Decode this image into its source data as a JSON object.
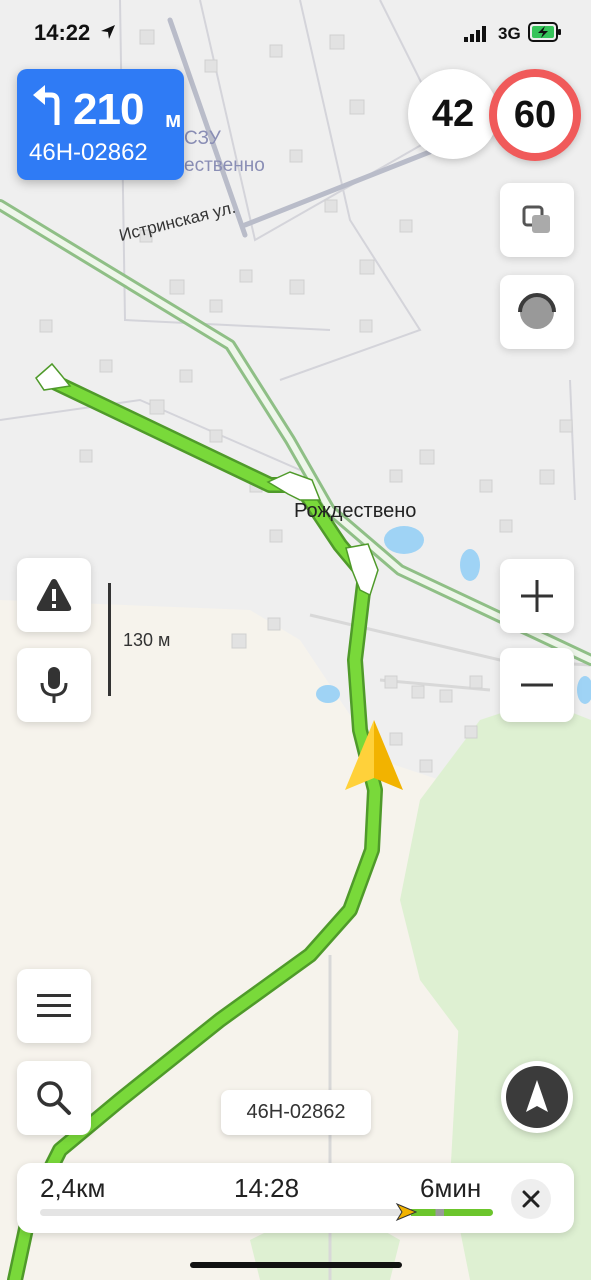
{
  "status_bar": {
    "time": "14:22",
    "network": "3G"
  },
  "maneuver": {
    "distance": "210",
    "unit": "м",
    "road": "46Н-02862",
    "turn": "left"
  },
  "speed": {
    "current": "42",
    "limit": "60"
  },
  "map": {
    "labels": {
      "street": "Истринская ул.",
      "village": "Рождествено",
      "snt_partial": "СЗУ",
      "snt_partial2": "ественно"
    },
    "scale": "130 м",
    "road_chip": "46Н-02862"
  },
  "route_summary": {
    "remaining_distance": "2,4км",
    "arrival_time": "14:28",
    "duration": "6мин",
    "progress_fraction": 0.82
  },
  "icons": [
    "layers-icon",
    "traffic-icon",
    "alert-icon",
    "mic-icon",
    "zoom-in-icon",
    "zoom-out-icon",
    "menu-icon",
    "search-icon",
    "compass-icon",
    "close-icon",
    "turn-left-icon",
    "location-arrow-icon",
    "signal-icon",
    "battery-icon",
    "navigation-cursor-icon"
  ],
  "colors": {
    "maneuver_bg": "#2f7bf5",
    "route": "#6cc52c",
    "speed_limit_ring": "#f05a5a"
  }
}
